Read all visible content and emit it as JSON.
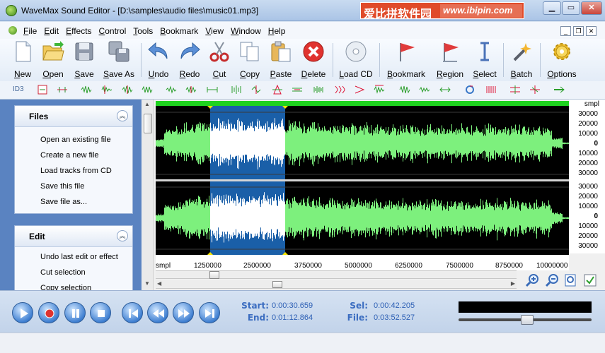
{
  "window": {
    "title": "WaveMax Sound Editor - [D:\\samples\\audio files\\music01.mp3]",
    "watermark_cn": "爱比拼软件园",
    "watermark_url": "www.ibipin.com"
  },
  "menu": [
    "File",
    "Edit",
    "Effects",
    "Control",
    "Tools",
    "Bookmark",
    "View",
    "Window",
    "Help"
  ],
  "toolbar": {
    "new": "New",
    "open": "Open",
    "save": "Save",
    "save_as": "Save As",
    "undo": "Undo",
    "redo": "Redo",
    "cut": "Cut",
    "copy": "Copy",
    "paste": "Paste",
    "delete": "Delete",
    "load_cd": "Load CD",
    "bookmark": "Bookmark",
    "region": "Region",
    "select": "Select",
    "batch": "Batch",
    "options": "Options"
  },
  "small_toolbar": {
    "id3": "ID3"
  },
  "tasks": {
    "files": {
      "header": "Files",
      "items": [
        "Open an existing file",
        "Create a new file",
        "Load tracks from CD",
        "Save this file",
        "Save file as..."
      ]
    },
    "edit": {
      "header": "Edit",
      "items": [
        "Undo last edit or effect",
        "Cut selection",
        "Copy selection"
      ]
    }
  },
  "ruler": {
    "unit": "smpl",
    "labels": [
      "30000",
      "20000",
      "10000",
      "0",
      "10000",
      "20000",
      "30000"
    ]
  },
  "xaxis": {
    "unit": "smpl",
    "labels": [
      "1250000",
      "2500000",
      "3750000",
      "5000000",
      "6250000",
      "7500000",
      "8750000",
      "10000000"
    ]
  },
  "transport": {
    "start_label": "Start:",
    "start_value": "0:00:30.659",
    "end_label": "End:",
    "end_value": "0:01:12.864",
    "sel_label": "Sel:",
    "sel_value": "0:00:42.205",
    "file_label": "File:",
    "file_value": "0:03:52.527"
  },
  "colors": {
    "waveform": "#7df07d",
    "selection": "#1a5fa8",
    "selected_wave": "#ffffff",
    "progress": "#1fd21f"
  }
}
